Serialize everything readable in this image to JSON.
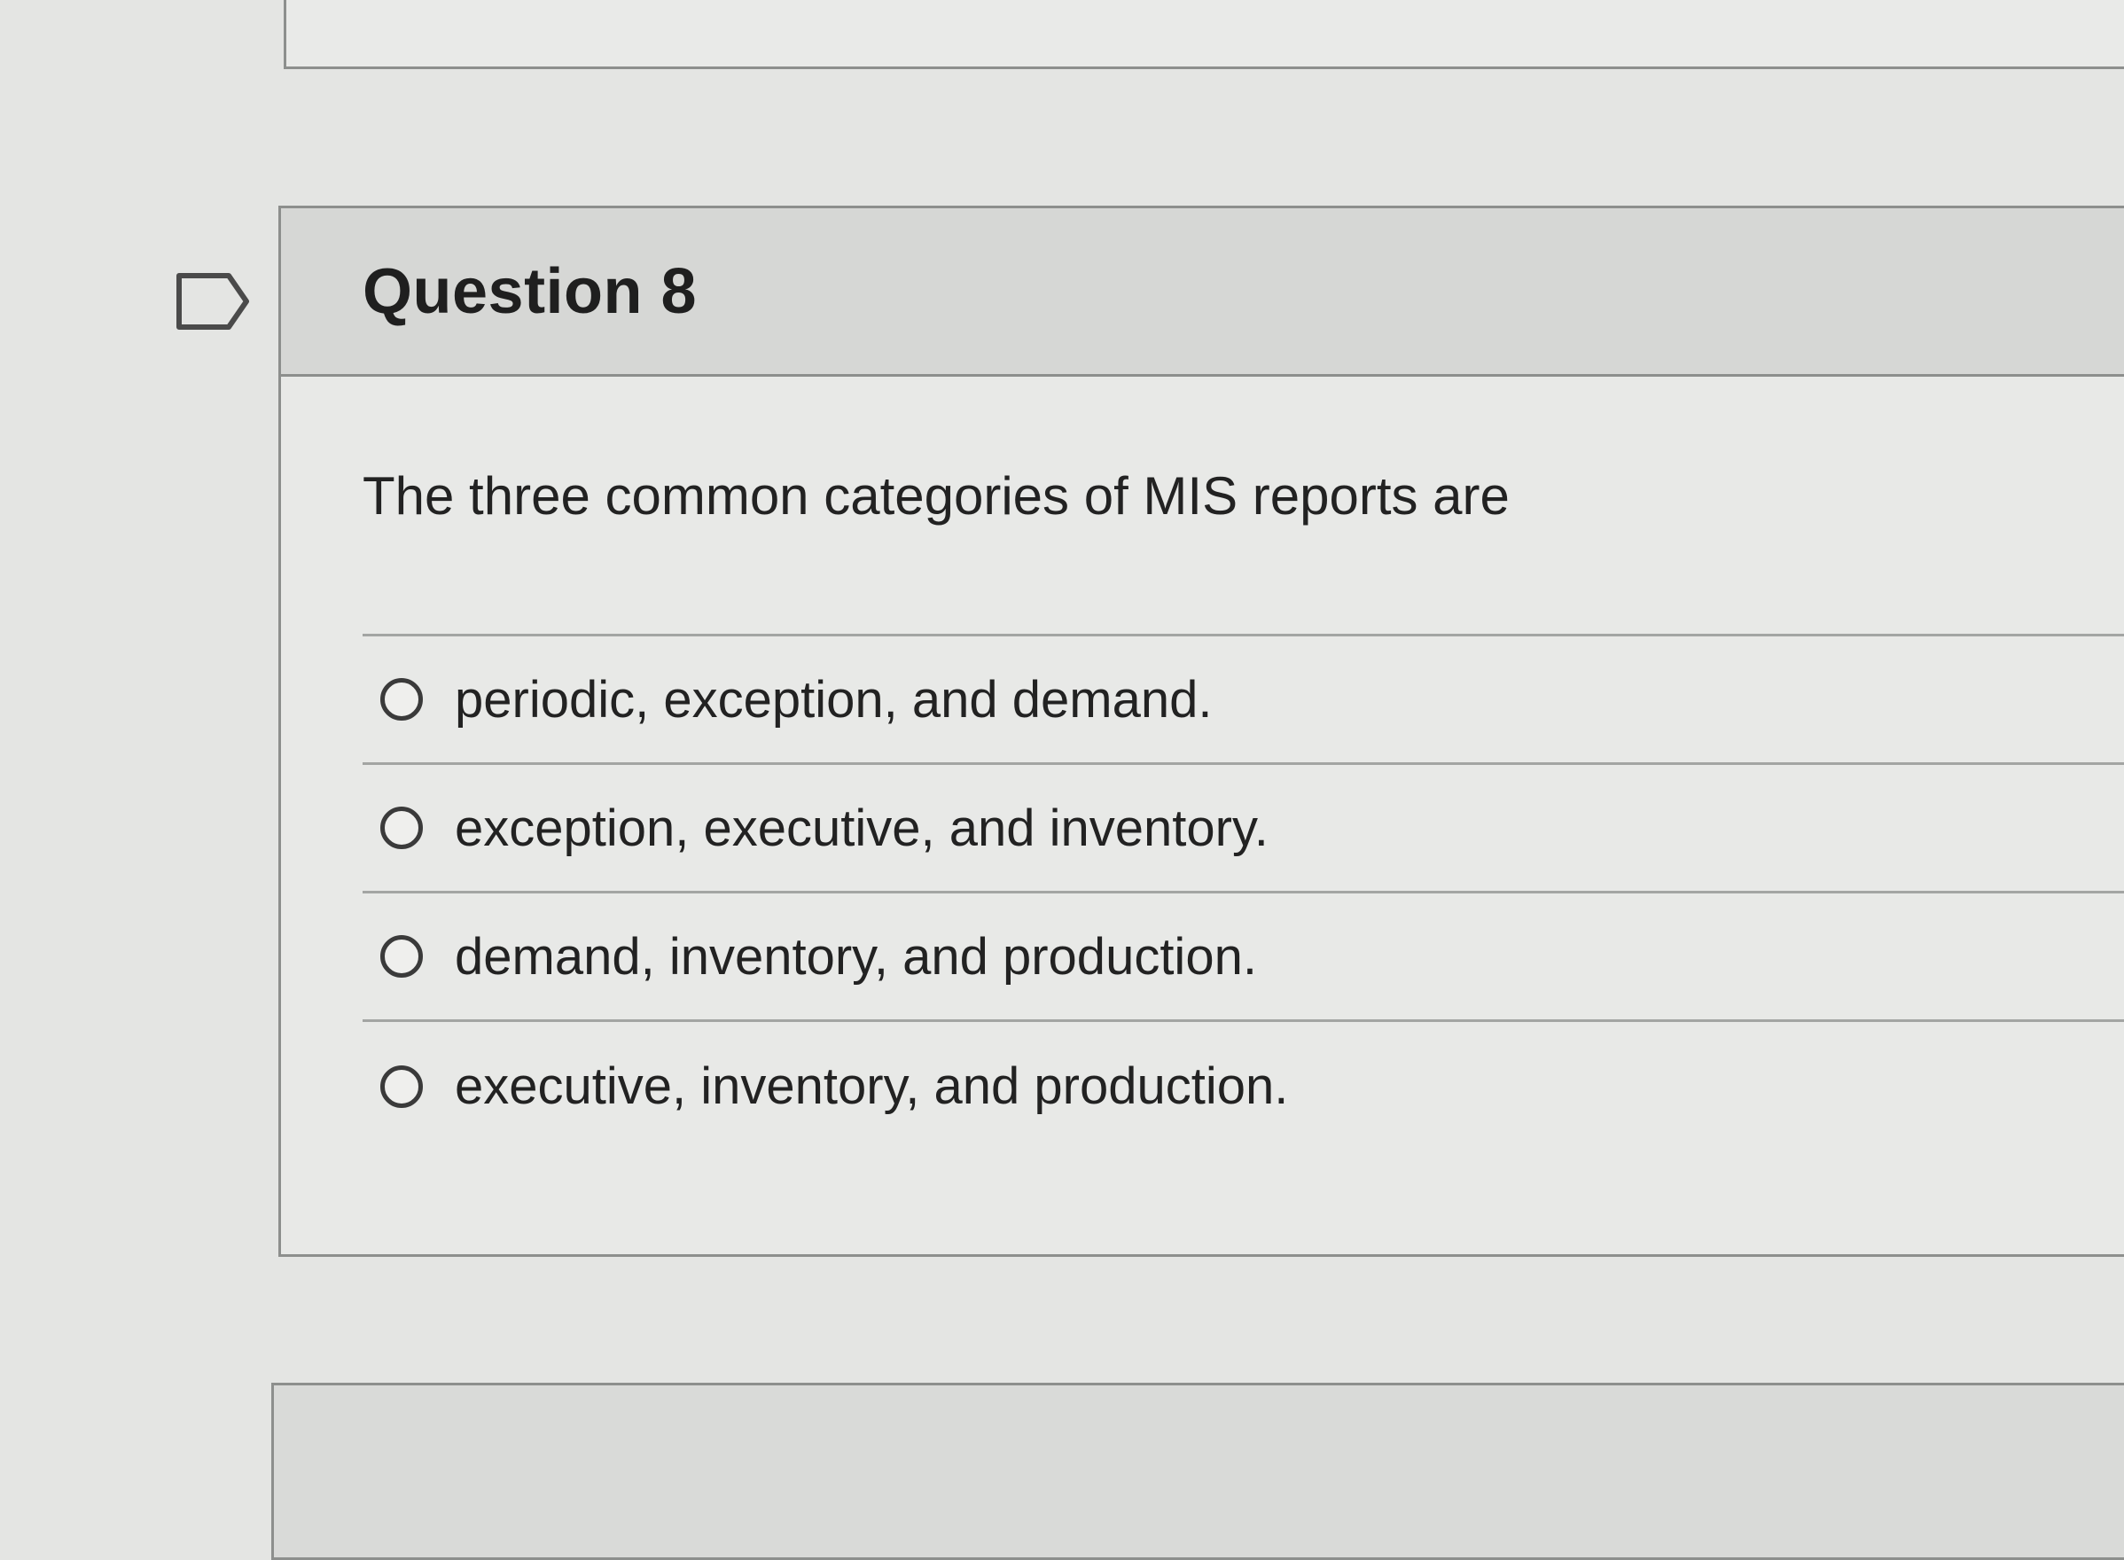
{
  "question": {
    "title": "Question 8",
    "text": "The three common categories of MIS reports are",
    "flag_icon": "flag-outline-icon",
    "answers": [
      {
        "label": "periodic, exception, and demand."
      },
      {
        "label": "exception, executive, and inventory."
      },
      {
        "label": "demand, inventory, and production."
      },
      {
        "label": "executive, inventory, and production."
      }
    ]
  }
}
